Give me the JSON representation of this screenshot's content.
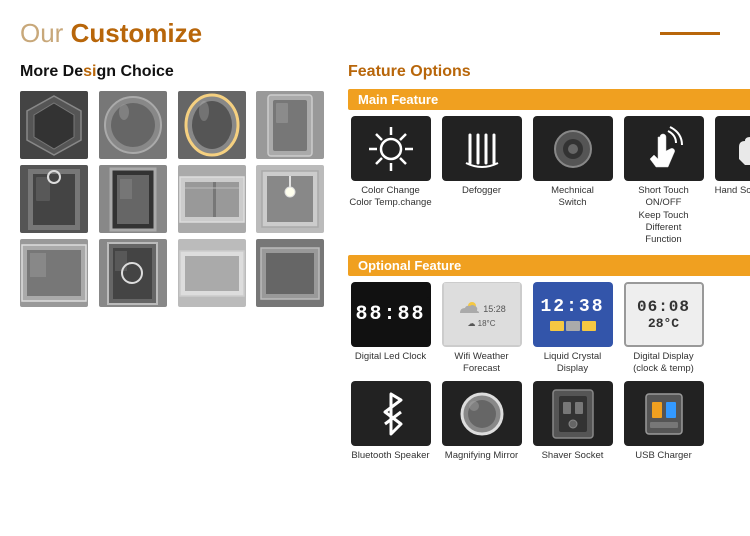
{
  "header": {
    "title_prefix": "Our ",
    "title_highlight": "Customize",
    "line": true
  },
  "left": {
    "section_title_plain": "More De",
    "section_title_highlight": "si",
    "section_title_rest": "gn Choice",
    "rows": [
      [
        "hex-mirror",
        "round-mirror",
        "oval-mirror",
        "portrait-mirror"
      ],
      [
        "portrait-frame",
        "portrait-dark",
        "landscape-frame",
        "square-mirror"
      ],
      [
        "square-light",
        "portrait-light",
        "landscape-light",
        "square-dark"
      ]
    ]
  },
  "right": {
    "section_title_plain": "Feature",
    "section_title_highlight": " Options",
    "main_feature": {
      "bar_label": "Main Feature",
      "items": [
        {
          "icon": "sun",
          "label": "Color Change\nColor Temp.change"
        },
        {
          "icon": "defog",
          "label": "Defogger"
        },
        {
          "icon": "switch",
          "label": "Mechanical\nSwitch"
        },
        {
          "icon": "touch",
          "label": "Short Touch ON/OFF\nKeep Touch Different\nFunction"
        },
        {
          "icon": "hand",
          "label": "Hand Scan Sensor"
        }
      ]
    },
    "optional_feature": {
      "bar_label": "Optional Feature",
      "items_row1": [
        {
          "icon": "clock",
          "label": "Digital Led Clock",
          "display": "88:88"
        },
        {
          "icon": "weather",
          "label": "Wifi Weather Forecast"
        },
        {
          "icon": "lcd",
          "label": "Liquid Crystal Display",
          "display": "12:38"
        },
        {
          "icon": "digital",
          "label": "Digital Display\n(clock & temp)",
          "display": "06:08\n28°C"
        }
      ],
      "items_row2": [
        {
          "icon": "bluetooth",
          "label": "Bluetooth Speaker"
        },
        {
          "icon": "magnify",
          "label": "Magnifying Mirror"
        },
        {
          "icon": "shaver",
          "label": "Shaver Socket"
        },
        {
          "icon": "usb",
          "label": "USB Charger"
        }
      ]
    }
  }
}
